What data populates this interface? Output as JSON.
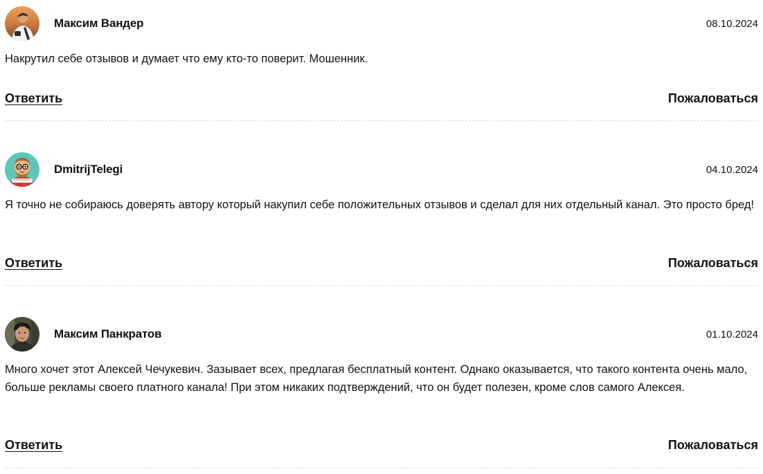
{
  "comments": [
    {
      "author": "Максим Вандер",
      "date": "08.10.2024",
      "avatar_icon": "user-photo-avatar",
      "text": "Накрутил себе отзывов и думает что ему кто-то поверит. Мошенник.",
      "reply_label": "Ответить",
      "report_label": "Пожаловаться"
    },
    {
      "author": "DmitrijTelegi",
      "date": "04.10.2024",
      "avatar_icon": "cartoon-avatar",
      "text": "Я точно не собираюсь доверять автору который накупил себе положительных отзывов и сделал для них отдельный канал. Это просто бред!",
      "reply_label": "Ответить",
      "report_label": "Пожаловаться"
    },
    {
      "author": "Максим Панкратов",
      "date": "01.10.2024",
      "avatar_icon": "user-photo-avatar",
      "text": "Много хочет этот Алексей Чечукевич. Зазывает всех, предлагая бесплатный контент. Однако оказывается, что такого контента очень мало, больше рекламы своего платного канала! При этом никаких подтверждений, что он будет полезен, кроме слов самого Алексея.",
      "reply_label": "Ответить",
      "report_label": "Пожаловаться"
    }
  ]
}
